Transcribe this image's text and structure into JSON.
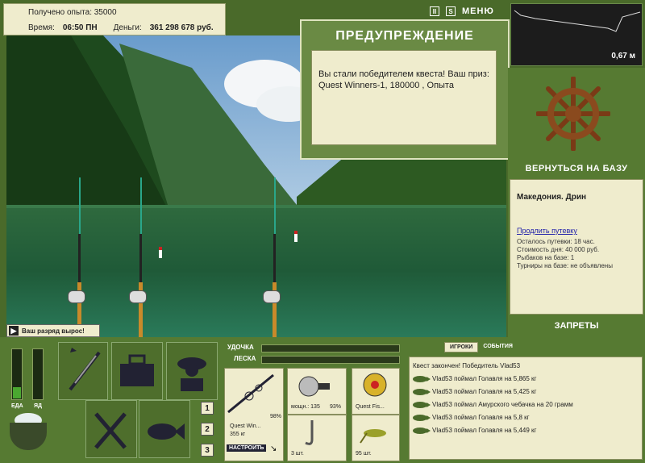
{
  "info": {
    "exp_label": "Получено опыта: 35000",
    "time_label": "Время:",
    "time_value": "06:50 ПН",
    "money_label": "Деньги:",
    "money_value": "361 298 678 руб."
  },
  "topbar": {
    "pause": "II",
    "sound": "S",
    "menu": "МЕНЮ"
  },
  "depth": {
    "value": "0,67 м"
  },
  "warning": {
    "title": "ПРЕДУПРЕЖДЕНИЕ",
    "text": "Вы стали победителем квеста! Ваш приз: Quest Winners-1, 180000 , Опыта"
  },
  "right_panel": {
    "return_label": "ВЕРНУТЬСЯ НА БАЗУ",
    "location": "Македония. Дрин",
    "extend_link": "Продлить путевку",
    "lines": [
      "Осталось путевки: 18 час.",
      "Стоимость дня: 40 000 руб.",
      "Рыбаков на базе: 1",
      "Турниры на базе: не объявлены"
    ],
    "bans_label": "ЗАПРЕТЫ"
  },
  "rank": {
    "text": "Ваш разряд вырос!"
  },
  "status_bars": {
    "food_label": "ЕДА",
    "poison_label": "ЯД"
  },
  "pages": [
    "1",
    "2",
    "3"
  ],
  "rod": {
    "rod_label": "УДОЧКА",
    "line_label": "ЛЕСКА",
    "rod_name": "Quest Win...",
    "rod_weight": "355 кг",
    "rod_pct": "98%",
    "setup_button": "НАСТРОИТЬ",
    "reel_power": "мощн.: 135",
    "reel_pct": "93%",
    "line_name": "Quest Fis...",
    "hook_count": "3 шт.",
    "bait_count": "95 шт."
  },
  "chat": {
    "tab_players": "ИГРОКИ",
    "tab_events": "СОБЫТИЯ",
    "header": "Квест закончен! Победитель Vlad53",
    "rows": [
      "Vlad53 поймал Голавля на 5,865 кг",
      "Vlad53 поймал Голавля на 5,425 кг",
      "Vlad53 поймал Амурского чебачка на 20 грамм",
      "Vlad53 поймал Голавля на 5,8 кг",
      "Vlad53 поймал Голавля на 5,449 кг"
    ]
  }
}
